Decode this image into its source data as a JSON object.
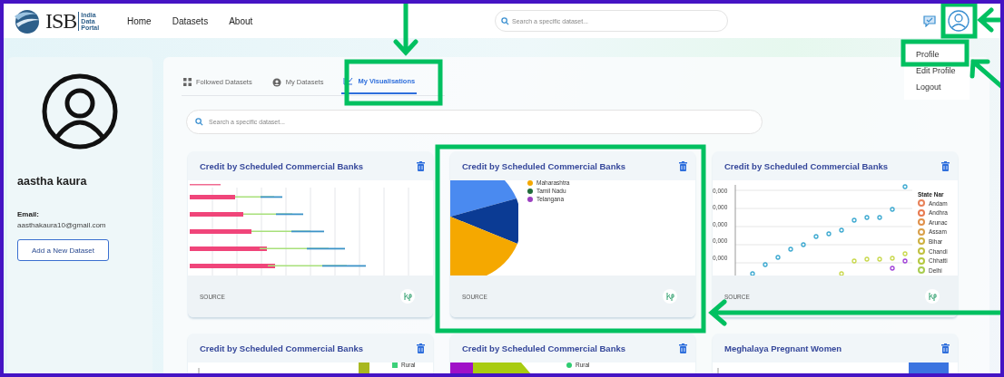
{
  "logo": {
    "name": "ISB",
    "sub": [
      "India",
      "Data",
      "Portal"
    ]
  },
  "nav": [
    {
      "label": "Home"
    },
    {
      "label": "Datasets"
    },
    {
      "label": "About"
    }
  ],
  "header_search": {
    "placeholder": "Search a specific dataset..."
  },
  "profile_menu": {
    "items": [
      {
        "label": "Profile"
      },
      {
        "label": "Edit Profile"
      },
      {
        "label": "Logout"
      }
    ]
  },
  "profile": {
    "name": "aastha kaura",
    "email_label": "Email:",
    "email": "aasthakaura10@gmail.com",
    "add_button": "Add a New Dataset"
  },
  "tabs": [
    {
      "label": "Followed Datasets",
      "selected": false
    },
    {
      "label": "My Datasets",
      "selected": false
    },
    {
      "label": "My Visualisations",
      "selected": true
    }
  ],
  "search": {
    "placeholder": "Search a specific dataset..."
  },
  "cards": [
    {
      "title": "Credit by Scheduled Commercial Banks",
      "kind": "bar",
      "source": "SOURCE"
    },
    {
      "title": "Credit by Scheduled Commercial Banks",
      "kind": "pie",
      "source": "SOURCE",
      "legend": [
        {
          "label": "Maharashtra",
          "color": "#f5a800"
        },
        {
          "label": "Tamil Nadu",
          "color": "#1f6b3a"
        },
        {
          "label": "Telangana",
          "color": "#9b3fc0"
        }
      ]
    },
    {
      "title": "Credit by Scheduled Commercial Banks",
      "kind": "scatter",
      "source": "SOURCE",
      "y_tick_labels": [
        "0,000",
        "0,000",
        "0,000",
        "0,000",
        "0,000"
      ],
      "legend_title": "State Nar",
      "legend": [
        {
          "label": "Andam",
          "color": "#e8825a"
        },
        {
          "label": "Andhra",
          "color": "#e87a50"
        },
        {
          "label": "Arunac",
          "color": "#e0904a"
        },
        {
          "label": "Assam",
          "color": "#d9a04a"
        },
        {
          "label": "Bihar",
          "color": "#cdb040"
        },
        {
          "label": "Chandi",
          "color": "#c0c040"
        },
        {
          "label": "Chhatti",
          "color": "#b5c840"
        },
        {
          "label": "Delhi",
          "color": "#a8cc50"
        }
      ]
    },
    {
      "title": "Credit by Scheduled Commercial Banks",
      "kind": "stacked",
      "legend": [
        {
          "label": "Rural",
          "color": "#3cd07a"
        }
      ]
    },
    {
      "title": "Credit by Scheduled Commercial Banks",
      "kind": "funnel",
      "legend": [
        {
          "label": "Rural",
          "color": "#2ecc71"
        }
      ]
    },
    {
      "title": "Meghalaya Pregnant Women",
      "kind": "column"
    }
  ]
}
